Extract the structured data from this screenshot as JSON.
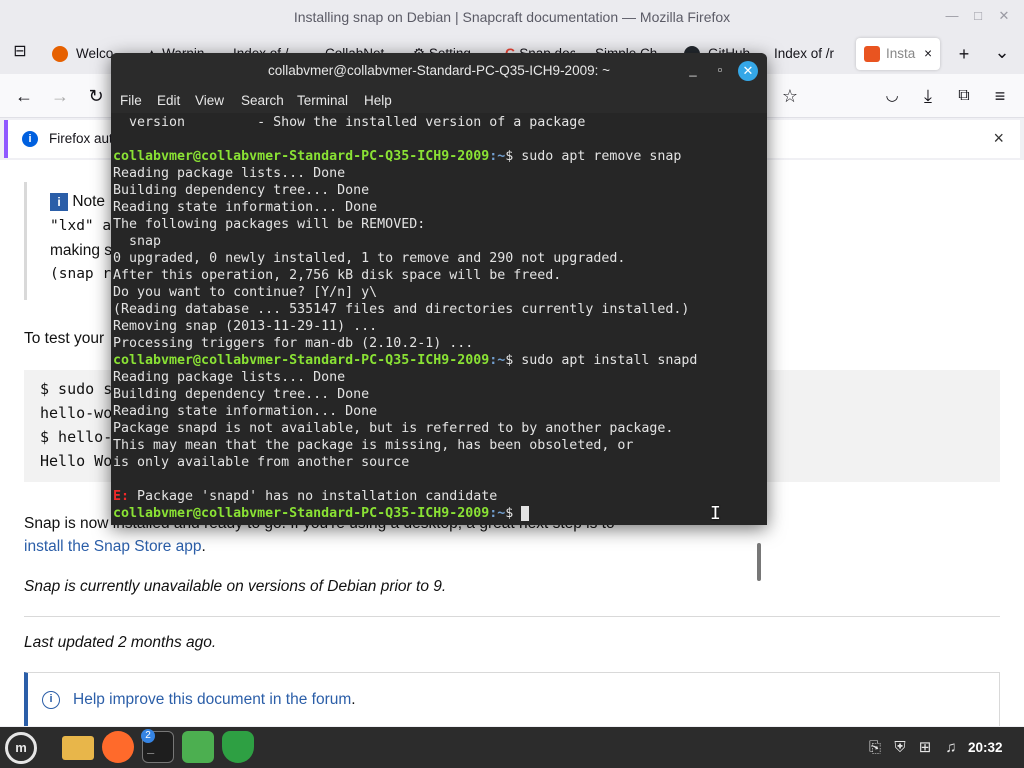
{
  "firefox": {
    "window_title": "Installing snap on Debian | Snapcraft documentation — Mozilla Firefox",
    "tabs": [
      {
        "label": "Welco",
        "favicon": "firefox-icon",
        "color": "#e66000"
      },
      {
        "label": "Warnin",
        "favicon": "warning-icon",
        "color": "#333333"
      },
      {
        "label": "Index of /",
        "favicon": "",
        "color": ""
      },
      {
        "label": "CollabNet",
        "favicon": "",
        "color": ""
      },
      {
        "label": "Setting",
        "favicon": "gear-icon",
        "color": "#555555"
      },
      {
        "label": "Snap doc",
        "favicon": "google-icon",
        "color": "#ea4335"
      },
      {
        "label": "Simple Ch",
        "favicon": "",
        "color": ""
      },
      {
        "label": "GitHub",
        "favicon": "github-icon",
        "color": "#24292f"
      },
      {
        "label": "Index of /r",
        "favicon": "",
        "color": ""
      },
      {
        "label": "Insta",
        "favicon": "snapcraft-icon",
        "color": "#e95420"
      }
    ],
    "new_tab_symbol": "+",
    "tab_list_symbol": "⌄",
    "notification": {
      "text": "Firefox aut",
      "close": "×"
    },
    "page": {
      "note_lines": [
        {
          "prefix": "Note",
          "rest": ""
        },
        {
          "prefix": "\"lxd\" a",
          "rest": ""
        },
        {
          "prefix": "making s",
          "rest": ""
        },
        {
          "prefix": "(snap r",
          "rest": ""
        }
      ],
      "test_intro": "To test your",
      "code_lines": [
        "$ sudo s",
        "hello-wo",
        "$ hello-",
        "Hello Wo"
      ],
      "installed_text": "Snap is now installed and ready to go. If you're using a desktop, a great next step is to",
      "store_link": "install the Snap Store app",
      "store_link_suffix": ".",
      "unavailable_text": "Snap is currently unavailable on versions of Debian prior to 9.",
      "last_updated": "Last updated 2 months ago.",
      "help_link": "Help improve this document in the forum",
      "help_suffix": "."
    }
  },
  "terminal": {
    "title": "collabvmer@collabvmer-Standard-PC-Q35-ICH9-2009: ~",
    "menu": [
      "File",
      "Edit",
      "View",
      "Search",
      "Terminal",
      "Help"
    ],
    "prompt_user": "collabvmer@collabvmer-Standard-PC-Q35-ICH9-2009",
    "prompt_path": ":~",
    "prompt_symbol": "$",
    "lines": [
      {
        "type": "out",
        "text": "  version         - Show the installed version of a package"
      },
      {
        "type": "blank",
        "text": ""
      },
      {
        "type": "prompt",
        "cmd": " sudo apt remove snap"
      },
      {
        "type": "out",
        "text": "Reading package lists... Done"
      },
      {
        "type": "out",
        "text": "Building dependency tree... Done"
      },
      {
        "type": "out",
        "text": "Reading state information... Done"
      },
      {
        "type": "out",
        "text": "The following packages will be REMOVED:"
      },
      {
        "type": "out",
        "text": "  snap"
      },
      {
        "type": "out",
        "text": "0 upgraded, 0 newly installed, 1 to remove and 290 not upgraded."
      },
      {
        "type": "out",
        "text": "After this operation, 2,756 kB disk space will be freed."
      },
      {
        "type": "out",
        "text": "Do you want to continue? [Y/n] y\\"
      },
      {
        "type": "out",
        "text": "(Reading database ... 535147 files and directories currently installed.)"
      },
      {
        "type": "out",
        "text": "Removing snap (2013-11-29-11) ..."
      },
      {
        "type": "out",
        "text": "Processing triggers for man-db (2.10.2-1) ..."
      },
      {
        "type": "prompt",
        "cmd": " sudo apt install snapd"
      },
      {
        "type": "out",
        "text": "Reading package lists... Done"
      },
      {
        "type": "out",
        "text": "Building dependency tree... Done"
      },
      {
        "type": "out",
        "text": "Reading state information... Done"
      },
      {
        "type": "out",
        "text": "Package snapd is not available, but is referred to by another package."
      },
      {
        "type": "out",
        "text": "This may mean that the package is missing, has been obsoleted, or"
      },
      {
        "type": "out",
        "text": "is only available from another source"
      },
      {
        "type": "blank",
        "text": ""
      },
      {
        "type": "error",
        "tag": "E:",
        "text": " Package 'snapd' has no installation candidate"
      },
      {
        "type": "prompt",
        "cmd": " "
      }
    ]
  },
  "taskbar": {
    "menu_icon": "mint-menu-icon",
    "apps": [
      {
        "name": "files-icon",
        "color": "#e8b64a"
      },
      {
        "name": "firefox-icon",
        "color": "#ff6a2b"
      },
      {
        "name": "terminal-icon",
        "color": "#1e1e1e"
      },
      {
        "name": "calculator-icon",
        "color": "#4caf50"
      },
      {
        "name": "shield-icon",
        "color": "#2ea043"
      }
    ],
    "terminal_badge": "2",
    "clock": "20:32"
  }
}
